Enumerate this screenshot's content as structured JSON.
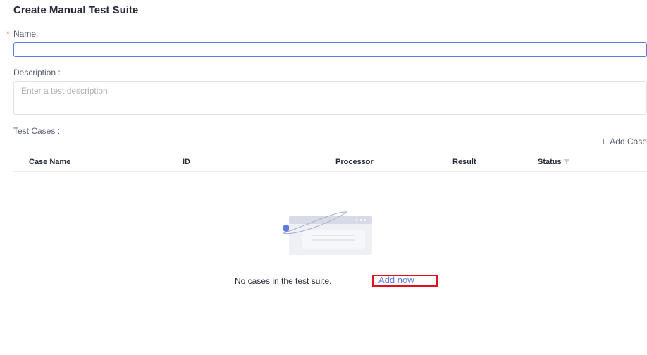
{
  "page": {
    "title": "Create Manual Test Suite"
  },
  "form": {
    "name_required_mark": "*",
    "name_label": "Name:",
    "name_value": "",
    "description_label": "Description :",
    "description_placeholder": "Enter a test description.",
    "test_cases_label": "Test Cases :"
  },
  "test_cases": {
    "add_case_label": "Add Case",
    "columns": [
      "Case Name",
      "ID",
      "Processor",
      "Result",
      "Status"
    ],
    "rows": [],
    "empty_message": "No cases in the test suite.",
    "add_now_label": "Add now"
  },
  "colors": {
    "accent": "#5e7ce0",
    "required": "#f66f6a",
    "highlight_box": "#e0101f"
  }
}
